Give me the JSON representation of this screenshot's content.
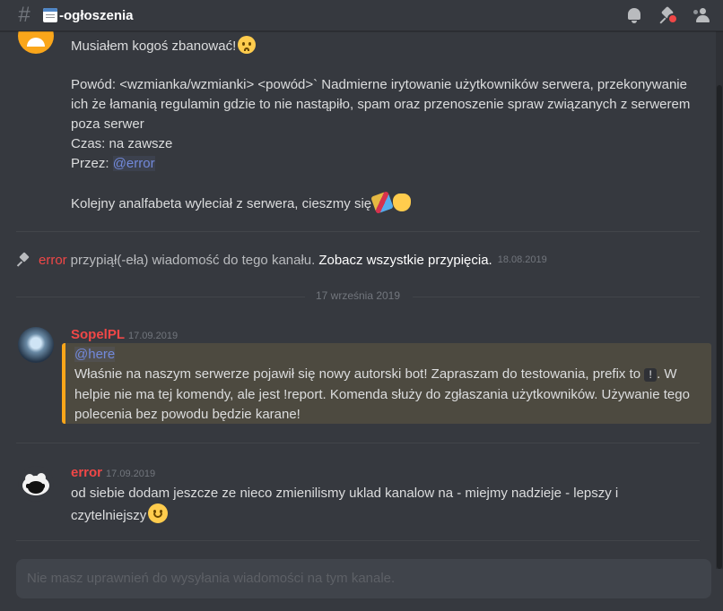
{
  "header": {
    "channel_name": "-ogłoszenia",
    "icons": [
      "hash-icon",
      "channel-notepad-icon",
      "bell-icon",
      "pin-icon",
      "members-icon"
    ]
  },
  "messages": {
    "bot_message": {
      "line1": "Musiałem kogoś zbanować!",
      "reason_line1": "Powód: <wzmianka/wzmianki> <powód>` Nadmierne irytowanie użytkowników serwera, przekonywanie",
      "reason_line2": "ich że łamanią regulamin gdzie to nie nastąpiło, spam oraz przenoszenie spraw związanych z serwerem",
      "reason_line3": "poza serwer",
      "time": "Czas: na zawsze",
      "by_label": "Przez:",
      "by_mention": "@error",
      "closing": "Kolejny analfabeta wyleciał z serwera, cieszmy się"
    },
    "pin_notice": {
      "user": "error",
      "text": "przypiął(-eła) wiadomość do tego kanału.",
      "link": "Zobacz wszystkie przypięcia.",
      "date": "18.08.2019"
    },
    "date_separator": "17 września 2019",
    "sopel": {
      "username": "SopelPL",
      "timestamp": "17.09.2019",
      "mention": "@here",
      "line1_pre": "Właśnie na naszym serwerze pojawił się nowy autorski bot! Zapraszam do testowania, prefix to",
      "prefix_code": "!",
      "line1_post": ". W",
      "line2": "helpie nie ma tej komendy, ale jest !report. Komenda służy do zgłaszania użytkowników. Używanie tego",
      "line3": "polecenia bez powodu będzie karane!"
    },
    "error_msg": {
      "username": "error",
      "timestamp": "17.09.2019",
      "line1": "od siebie dodam jeszcze ze nieco zmienilismy uklad kanalow na - miejmy nadzieje - lepszy i",
      "line2": "czytelniejszy"
    }
  },
  "input": {
    "placeholder": "Nie masz uprawnień do wysyłania wiadomości na tym kanale."
  },
  "colors": {
    "background": "#36393f",
    "username_red": "#f04747",
    "mention_blue": "#7289da",
    "embed_accent": "#faa61a"
  }
}
